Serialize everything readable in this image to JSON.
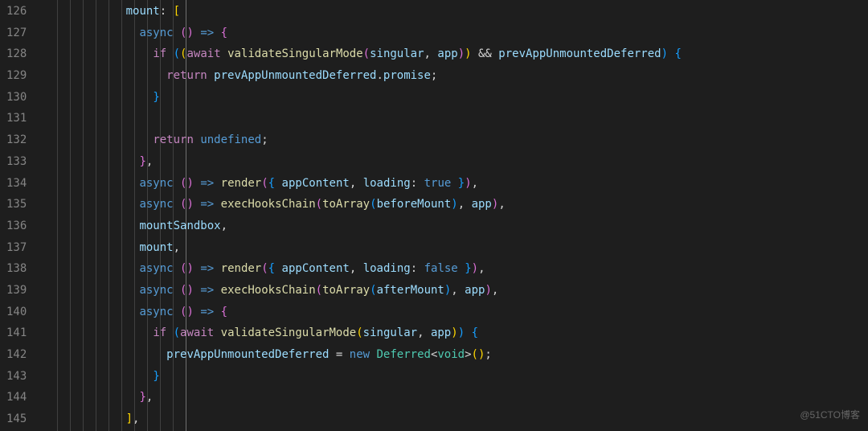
{
  "gutter": {
    "start": 126,
    "end": 145
  },
  "code": {
    "l126": {
      "indent": 10,
      "tokens": [
        [
          "var",
          "mount"
        ],
        [
          "punct",
          ":"
        ],
        [
          "punct",
          " "
        ],
        [
          "bracket-y",
          "["
        ]
      ]
    },
    "l127": {
      "indent": 12,
      "tokens": [
        [
          "storage",
          "async"
        ],
        [
          "punct",
          " "
        ],
        [
          "bracket-p",
          "("
        ],
        [
          "bracket-p",
          ")"
        ],
        [
          "punct",
          " "
        ],
        [
          "storage",
          "=>"
        ],
        [
          "punct",
          " "
        ],
        [
          "bracket-p",
          "{"
        ]
      ]
    },
    "l128": {
      "indent": 14,
      "tokens": [
        [
          "keyword",
          "if"
        ],
        [
          "punct",
          " "
        ],
        [
          "bracket-b",
          "("
        ],
        [
          "bracket-y",
          "("
        ],
        [
          "keyword",
          "await"
        ],
        [
          "punct",
          " "
        ],
        [
          "func",
          "validateSingularMode"
        ],
        [
          "bracket-p",
          "("
        ],
        [
          "var",
          "singular"
        ],
        [
          "punct",
          ", "
        ],
        [
          "var",
          "app"
        ],
        [
          "bracket-p",
          ")"
        ],
        [
          "bracket-y",
          ")"
        ],
        [
          "punct",
          " "
        ],
        [
          "op",
          "&&"
        ],
        [
          "punct",
          " "
        ],
        [
          "var",
          "prevAppUnmountedDeferred"
        ],
        [
          "bracket-b",
          ")"
        ],
        [
          "punct",
          " "
        ],
        [
          "bracket-b",
          "{"
        ]
      ]
    },
    "l129": {
      "indent": 16,
      "tokens": [
        [
          "keyword",
          "return"
        ],
        [
          "punct",
          " "
        ],
        [
          "var",
          "prevAppUnmountedDeferred"
        ],
        [
          "punct",
          "."
        ],
        [
          "var",
          "promise"
        ],
        [
          "punct",
          ";"
        ]
      ]
    },
    "l130": {
      "indent": 14,
      "tokens": [
        [
          "bracket-b",
          "}"
        ]
      ]
    },
    "l131": {
      "indent": 0,
      "tokens": []
    },
    "l132": {
      "indent": 14,
      "tokens": [
        [
          "keyword",
          "return"
        ],
        [
          "punct",
          " "
        ],
        [
          "const",
          "undefined"
        ],
        [
          "punct",
          ";"
        ]
      ]
    },
    "l133": {
      "indent": 12,
      "tokens": [
        [
          "bracket-p",
          "}"
        ],
        [
          "punct",
          ","
        ]
      ]
    },
    "l134": {
      "indent": 12,
      "tokens": [
        [
          "storage",
          "async"
        ],
        [
          "punct",
          " "
        ],
        [
          "bracket-p",
          "("
        ],
        [
          "bracket-p",
          ")"
        ],
        [
          "punct",
          " "
        ],
        [
          "storage",
          "=>"
        ],
        [
          "punct",
          " "
        ],
        [
          "func",
          "render"
        ],
        [
          "bracket-p",
          "("
        ],
        [
          "bracket-b",
          "{"
        ],
        [
          "punct",
          " "
        ],
        [
          "var",
          "appContent"
        ],
        [
          "punct",
          ", "
        ],
        [
          "var",
          "loading"
        ],
        [
          "punct",
          ":"
        ],
        [
          "punct",
          " "
        ],
        [
          "const",
          "true"
        ],
        [
          "punct",
          " "
        ],
        [
          "bracket-b",
          "}"
        ],
        [
          "bracket-p",
          ")"
        ],
        [
          "punct",
          ","
        ]
      ]
    },
    "l135": {
      "indent": 12,
      "tokens": [
        [
          "storage",
          "async"
        ],
        [
          "punct",
          " "
        ],
        [
          "bracket-p",
          "("
        ],
        [
          "bracket-p",
          ")"
        ],
        [
          "punct",
          " "
        ],
        [
          "storage",
          "=>"
        ],
        [
          "punct",
          " "
        ],
        [
          "func",
          "execHooksChain"
        ],
        [
          "bracket-p",
          "("
        ],
        [
          "func",
          "toArray"
        ],
        [
          "bracket-b",
          "("
        ],
        [
          "var",
          "beforeMount"
        ],
        [
          "bracket-b",
          ")"
        ],
        [
          "punct",
          ", "
        ],
        [
          "var",
          "app"
        ],
        [
          "bracket-p",
          ")"
        ],
        [
          "punct",
          ","
        ]
      ]
    },
    "l136": {
      "indent": 12,
      "tokens": [
        [
          "var",
          "mountSandbox"
        ],
        [
          "punct",
          ","
        ]
      ]
    },
    "l137": {
      "indent": 12,
      "tokens": [
        [
          "var",
          "mount"
        ],
        [
          "punct",
          ","
        ]
      ]
    },
    "l138": {
      "indent": 12,
      "tokens": [
        [
          "storage",
          "async"
        ],
        [
          "punct",
          " "
        ],
        [
          "bracket-p",
          "("
        ],
        [
          "bracket-p",
          ")"
        ],
        [
          "punct",
          " "
        ],
        [
          "storage",
          "=>"
        ],
        [
          "punct",
          " "
        ],
        [
          "func",
          "render"
        ],
        [
          "bracket-p",
          "("
        ],
        [
          "bracket-b",
          "{"
        ],
        [
          "punct",
          " "
        ],
        [
          "var",
          "appContent"
        ],
        [
          "punct",
          ", "
        ],
        [
          "var",
          "loading"
        ],
        [
          "punct",
          ":"
        ],
        [
          "punct",
          " "
        ],
        [
          "const",
          "false"
        ],
        [
          "punct",
          " "
        ],
        [
          "bracket-b",
          "}"
        ],
        [
          "bracket-p",
          ")"
        ],
        [
          "punct",
          ","
        ]
      ]
    },
    "l139": {
      "indent": 12,
      "tokens": [
        [
          "storage",
          "async"
        ],
        [
          "punct",
          " "
        ],
        [
          "bracket-p",
          "("
        ],
        [
          "bracket-p",
          ")"
        ],
        [
          "punct",
          " "
        ],
        [
          "storage",
          "=>"
        ],
        [
          "punct",
          " "
        ],
        [
          "func",
          "execHooksChain"
        ],
        [
          "bracket-p",
          "("
        ],
        [
          "func",
          "toArray"
        ],
        [
          "bracket-b",
          "("
        ],
        [
          "var",
          "afterMount"
        ],
        [
          "bracket-b",
          ")"
        ],
        [
          "punct",
          ", "
        ],
        [
          "var",
          "app"
        ],
        [
          "bracket-p",
          ")"
        ],
        [
          "punct",
          ","
        ]
      ]
    },
    "l140": {
      "indent": 12,
      "tokens": [
        [
          "storage",
          "async"
        ],
        [
          "punct",
          " "
        ],
        [
          "bracket-p",
          "("
        ],
        [
          "bracket-p",
          ")"
        ],
        [
          "punct",
          " "
        ],
        [
          "storage",
          "=>"
        ],
        [
          "punct",
          " "
        ],
        [
          "bracket-p",
          "{"
        ]
      ]
    },
    "l141": {
      "indent": 14,
      "tokens": [
        [
          "keyword",
          "if"
        ],
        [
          "punct",
          " "
        ],
        [
          "bracket-b",
          "("
        ],
        [
          "keyword",
          "await"
        ],
        [
          "punct",
          " "
        ],
        [
          "func",
          "validateSingularMode"
        ],
        [
          "bracket-y",
          "("
        ],
        [
          "var",
          "singular"
        ],
        [
          "punct",
          ", "
        ],
        [
          "var",
          "app"
        ],
        [
          "bracket-y",
          ")"
        ],
        [
          "bracket-b",
          ")"
        ],
        [
          "punct",
          " "
        ],
        [
          "bracket-b",
          "{"
        ]
      ]
    },
    "l142": {
      "indent": 16,
      "tokens": [
        [
          "var",
          "prevAppUnmountedDeferred"
        ],
        [
          "punct",
          " "
        ],
        [
          "op",
          "="
        ],
        [
          "punct",
          " "
        ],
        [
          "new",
          "new"
        ],
        [
          "punct",
          " "
        ],
        [
          "type",
          "Deferred"
        ],
        [
          "punct",
          "<"
        ],
        [
          "type",
          "void"
        ],
        [
          "punct",
          ">"
        ],
        [
          "bracket-y",
          "("
        ],
        [
          "bracket-y",
          ")"
        ],
        [
          "punct",
          ";"
        ]
      ]
    },
    "l143": {
      "indent": 14,
      "tokens": [
        [
          "bracket-b",
          "}"
        ]
      ]
    },
    "l144": {
      "indent": 12,
      "tokens": [
        [
          "bracket-p",
          "}"
        ],
        [
          "punct",
          ","
        ]
      ]
    },
    "l145": {
      "indent": 10,
      "tokens": [
        [
          "bracket-y",
          "]"
        ],
        [
          "punct",
          ","
        ]
      ]
    }
  },
  "watermark": "@51CTO博客"
}
